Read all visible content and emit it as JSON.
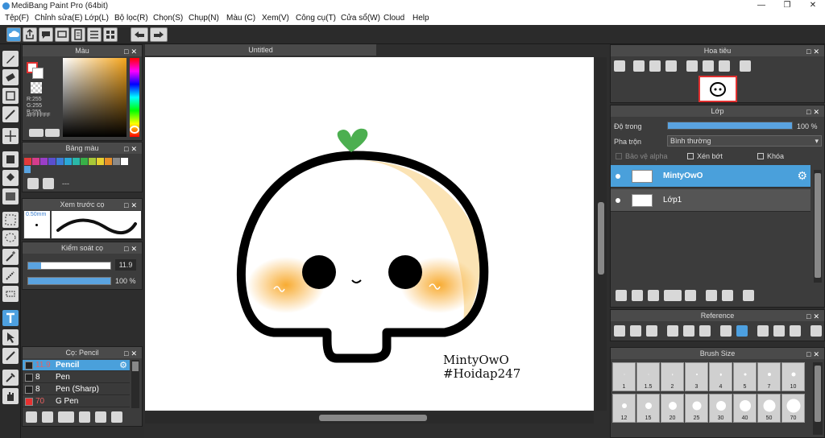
{
  "app": {
    "title": "MediBang Paint Pro (64bit)"
  },
  "menu": [
    "Tệp(F)",
    "Chỉnh sửa(E)",
    "Lớp(L)",
    "Bộ lọc(R)",
    "Chọn(S)",
    "Chụp(N)",
    "Màu (C)",
    "Xem(V)",
    "Công cụ(T)",
    "Cửa sổ(W)",
    "Cloud",
    "Help"
  ],
  "document": {
    "tab": "Untitled",
    "signature_line1": "MintyOwO",
    "signature_line2": "#Hoidap247"
  },
  "color_panel": {
    "title": "Màu",
    "r": "R:255",
    "g": "G:255",
    "b": "B:255",
    "hex": "#FFFFFF"
  },
  "palette_panel": {
    "title": "Bảng màu",
    "more": "---",
    "swatches": [
      "#e23b3b",
      "#d63c8c",
      "#9b3ec8",
      "#5a4fd0",
      "#3b7fd8",
      "#2aa8d8",
      "#2ab8a8",
      "#38b048",
      "#a8c838",
      "#e8d030",
      "#e89028",
      "#8a8a8a",
      "#ffffff"
    ]
  },
  "brush_preview_panel": {
    "title": "Xem trước cọ",
    "size": "0.50mm"
  },
  "brush_control_panel": {
    "title": "Kiểm soát cọ",
    "size_value": "11.9",
    "opacity_value": "100 %",
    "size_fraction": 0.16,
    "opacity_fraction": 1.0
  },
  "brush_list_panel": {
    "title": "Cọ: Pencil",
    "items": [
      {
        "size": "11.9",
        "name": "Pencil",
        "color": "#222222"
      },
      {
        "size": "8",
        "name": "Pen",
        "color": "#222222"
      },
      {
        "size": "8",
        "name": "Pen (Sharp)",
        "color": "#222222"
      },
      {
        "size": "70",
        "name": "G Pen",
        "color": "#e83030"
      }
    ]
  },
  "navigator_panel": {
    "title": "Hoa tiêu"
  },
  "layer_panel": {
    "title": "Lớp",
    "opacity_label": "Độ trong",
    "opacity_value": "100 %",
    "opacity_fraction": 1.0,
    "blend_label": "Pha trộn",
    "blend_value": "Bình thường",
    "protect_alpha": "Bảo vệ alpha",
    "clipping": "Xén bớt",
    "lock": "Khóa",
    "layers": [
      {
        "name": "MintyOwO"
      },
      {
        "name": "Lớp1"
      }
    ]
  },
  "reference_panel": {
    "title": "Reference"
  },
  "brush_size_panel": {
    "title": "Brush Size",
    "sizes": [
      "1",
      "1.5",
      "2",
      "3",
      "4",
      "5",
      "7",
      "10",
      "12",
      "15",
      "20",
      "25",
      "30",
      "40",
      "50",
      "70"
    ]
  }
}
